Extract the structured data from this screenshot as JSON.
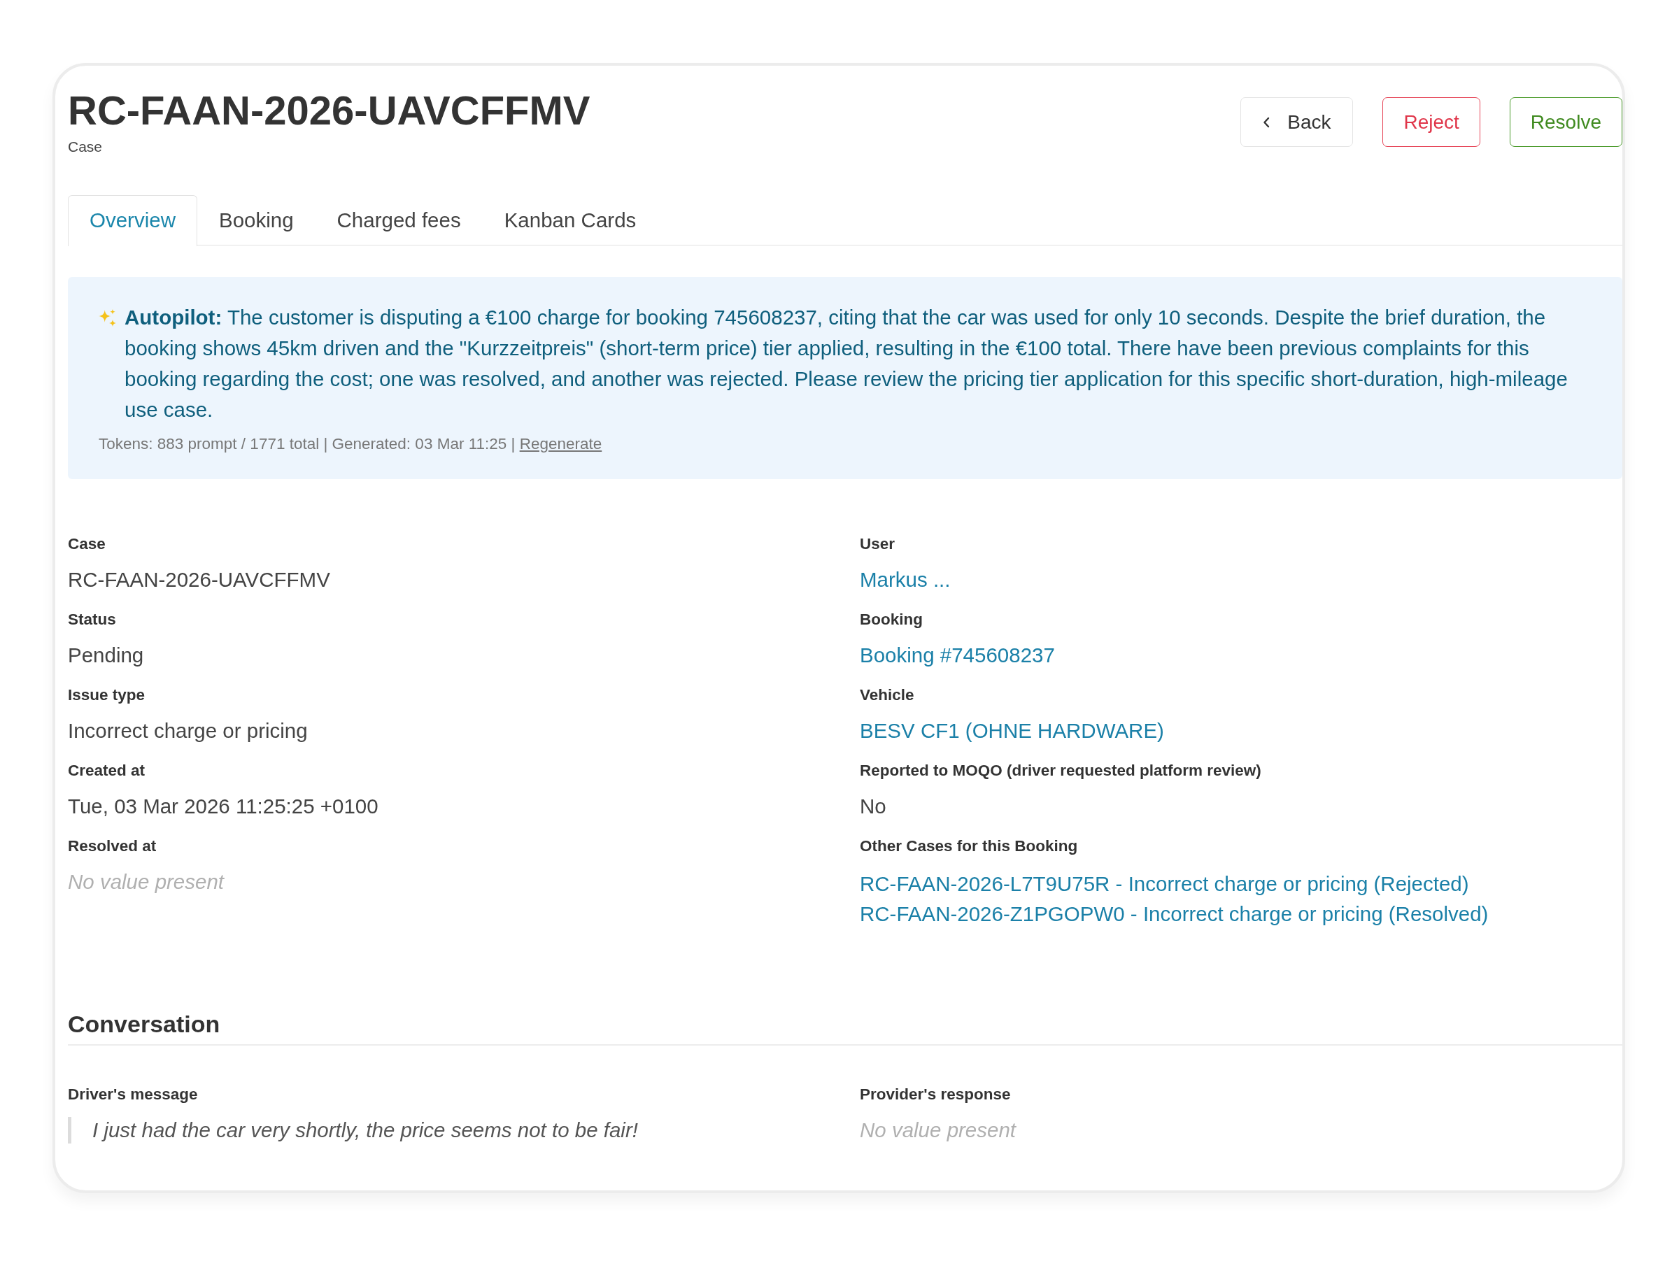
{
  "header": {
    "title": "RC-FAAN-2026-UAVCFFMV",
    "subtitle": "Case"
  },
  "actions": [
    {
      "label": "Back",
      "kind": "back"
    },
    {
      "label": "Reject",
      "kind": "reject"
    },
    {
      "label": "Resolve",
      "kind": "resolve"
    }
  ],
  "tabs": [
    {
      "label": "Overview",
      "selected": true
    },
    {
      "label": "Booking",
      "selected": false
    },
    {
      "label": "Charged fees",
      "selected": false
    },
    {
      "label": "Kanban Cards",
      "selected": false
    }
  ],
  "autopilot": {
    "summary": "**Autopilot:** The customer is disputing a €100 charge for booking 745608237, citing that the car was used for only 10 seconds. Despite the brief duration, the booking shows 45km driven and the \"Kurzzeitpreis\" (short-term price) tier applied, resulting in the €100 total. There have been previous complaints for this booking regarding the cost; one was resolved, and another was rejected. Please review the pricing tier application for this specific short-duration, high-mileage use case.",
    "meta": "Tokens: 883 prompt / 1771 total | Generated: 03 Mar 11:25 |",
    "link": "Regenerate"
  },
  "details": {
    "left": [
      {
        "label": "Case",
        "kind": "text",
        "value": "RC-FAAN-2026-UAVCFFMV"
      },
      {
        "label": "Status",
        "kind": "text",
        "value": "Pending"
      },
      {
        "label": "Issue type",
        "kind": "text",
        "value": "Incorrect charge or pricing"
      },
      {
        "label": "Created at",
        "kind": "text",
        "value": "Tue, 03 Mar 2026 11:25:25 +0100"
      },
      {
        "label": "Resolved at",
        "kind": "empty",
        "value": "No value present"
      }
    ],
    "right": [
      {
        "label": "User",
        "kind": "link",
        "value": "Markus ..."
      },
      {
        "label": "Booking",
        "kind": "link",
        "value": "Booking #745608237"
      },
      {
        "label": "Vehicle",
        "kind": "link",
        "value": "BESV CF1 (OHNE HARDWARE)"
      },
      {
        "label": "Reported to MOQO (driver requested platform review)",
        "kind": "text",
        "value": "No"
      },
      {
        "label": "Other Cases for this Booking",
        "kind": "links",
        "values": [
          "RC-FAAN-2026-L7T9U75R - Incorrect charge or pricing (Rejected)",
          "RC-FAAN-2026-Z1PGOPW0 - Incorrect charge or pricing (Resolved)"
        ]
      }
    ]
  },
  "conversation": {
    "title": "Conversation",
    "fields": [
      {
        "label": "Driver's message",
        "kind": "quote",
        "value": "I just had the car very shortly, the price seems not to be fair!"
      },
      {
        "label": "Provider's response",
        "kind": "empty",
        "value": "No value present"
      }
    ]
  }
}
